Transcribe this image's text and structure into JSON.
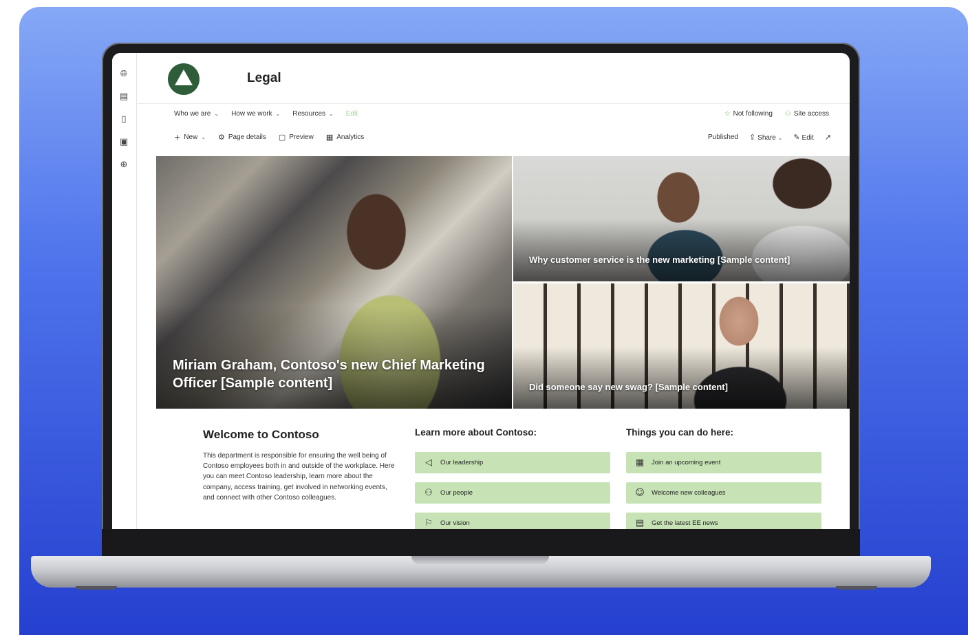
{
  "site": {
    "title": "Legal"
  },
  "rail": {
    "icons": [
      "globe-icon",
      "news-icon",
      "file-icon",
      "database-icon",
      "add-icon"
    ]
  },
  "nav": {
    "items": [
      {
        "label": "Who we are"
      },
      {
        "label": "How we work"
      },
      {
        "label": "Resources"
      }
    ],
    "edit_label": "Edit",
    "not_following": "Not following",
    "site_access": "Site access"
  },
  "command_bar": {
    "new_label": "New",
    "page_details": "Page details",
    "preview": "Preview",
    "analytics": "Analytics",
    "published": "Published",
    "share": "Share",
    "edit": "Edit"
  },
  "hero": {
    "main_caption": "Miriam Graham, Contoso's new Chief Marketing Officer [Sample content]",
    "tile2_caption": "Why customer service is the new marketing [Sample content]",
    "tile3_caption": "Did someone say new swag? [Sample content]"
  },
  "welcome": {
    "title": "Welcome to Contoso",
    "body": "This department is responsible for ensuring the well being of Contoso employees both in and outside of the workplace. Here you can meet Contoso leadership, learn more about the company, access training, get involved in networking events, and connect with other Contoso colleagues."
  },
  "learn_more": {
    "title": "Learn more about Contoso:",
    "links": [
      {
        "label": "Our leadership",
        "icon": "megaphone-icon"
      },
      {
        "label": "Our people",
        "icon": "people-icon"
      },
      {
        "label": "Our vision",
        "icon": "flag-icon"
      }
    ]
  },
  "things_to_do": {
    "title": "Things you can do here:",
    "links": [
      {
        "label": "Join an upcoming event",
        "icon": "calendar-icon"
      },
      {
        "label": "Welcome new colleagues",
        "icon": "smile-icon"
      },
      {
        "label": "Get the latest EE news",
        "icon": "news-icon"
      }
    ]
  },
  "colors": {
    "quick_link_bg": "#c7e3b6",
    "background_gradient_top": "#86a8f6",
    "background_gradient_bottom": "#2540cf",
    "logo": "#2f5d3a"
  }
}
